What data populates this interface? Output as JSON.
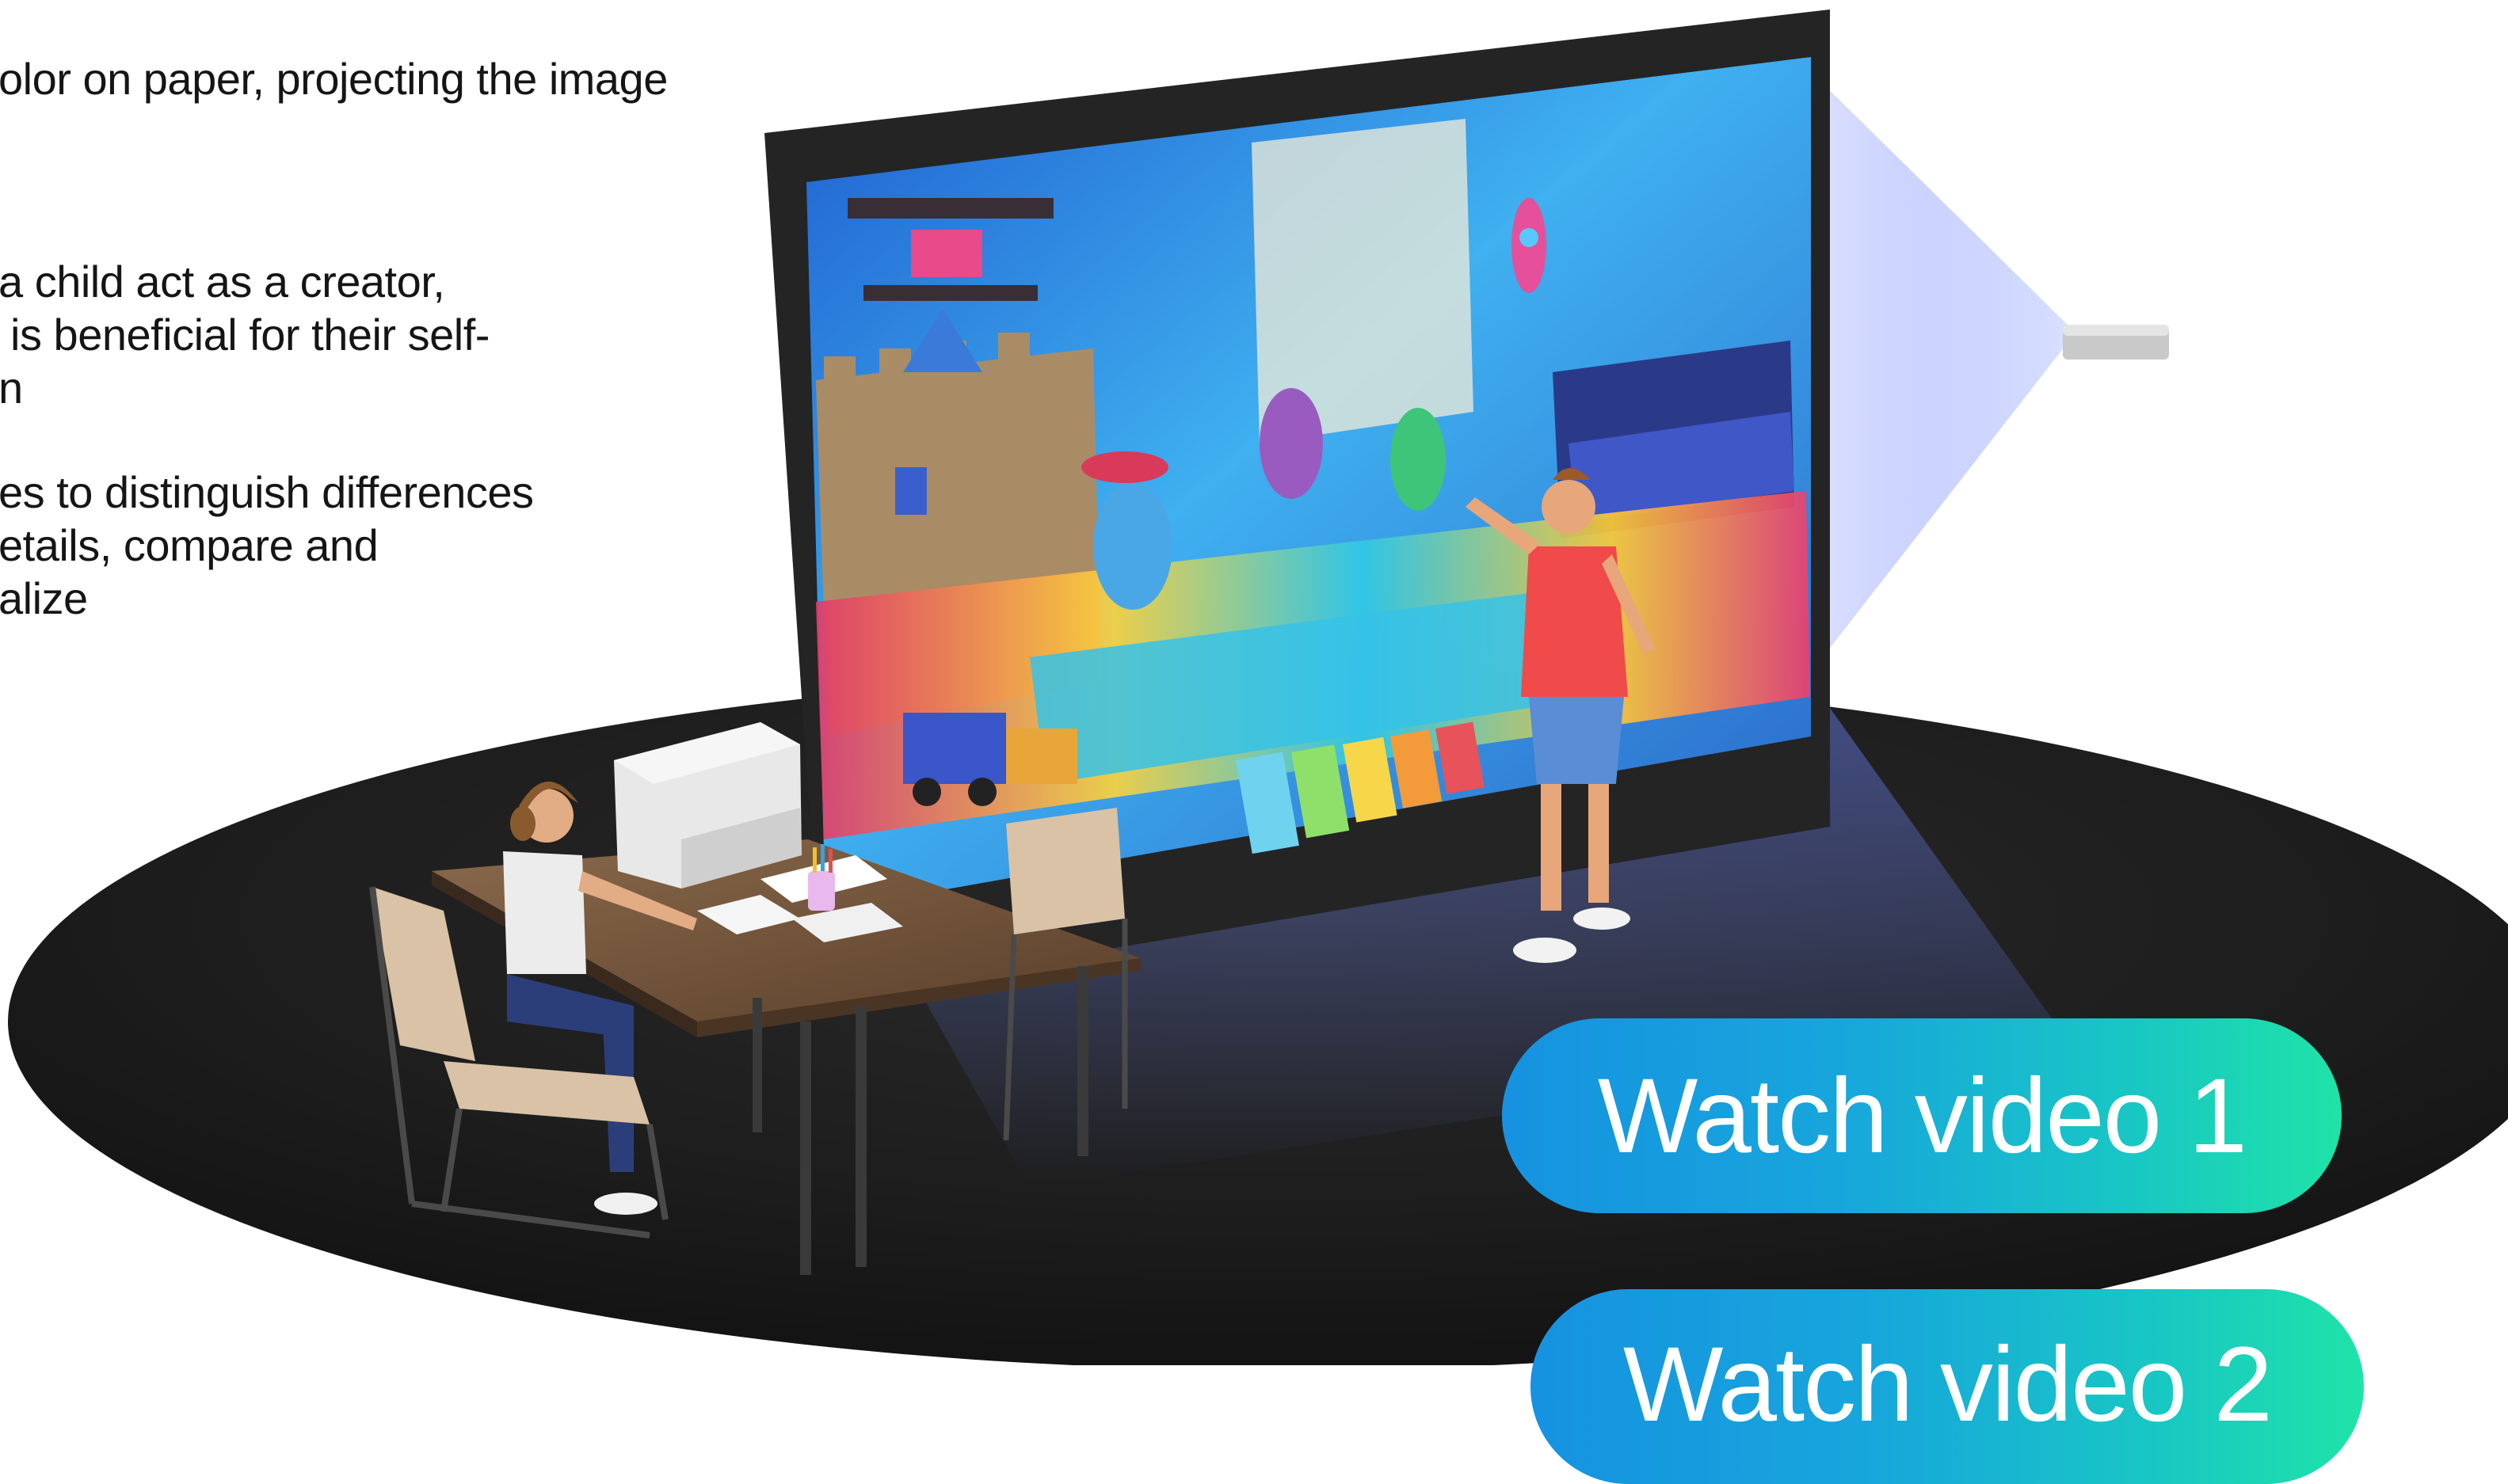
{
  "description_text": {
    "line1": "olor on paper, projecting the image",
    "para2": [
      "a child act as a creator,",
      " is beneficial for their self-",
      "n"
    ],
    "para3": [
      "es to distinguish differences",
      "etails, compare and",
      "alize"
    ]
  },
  "buttons": {
    "watch_video_1": "Watch video 1",
    "watch_video_2": "Watch video 2"
  },
  "colors": {
    "button_gradient_start": "#1692e0",
    "button_gradient_end": "#1fe3a8",
    "floor": "#1c1c1c",
    "screen_frame": "#2a2a2a"
  }
}
